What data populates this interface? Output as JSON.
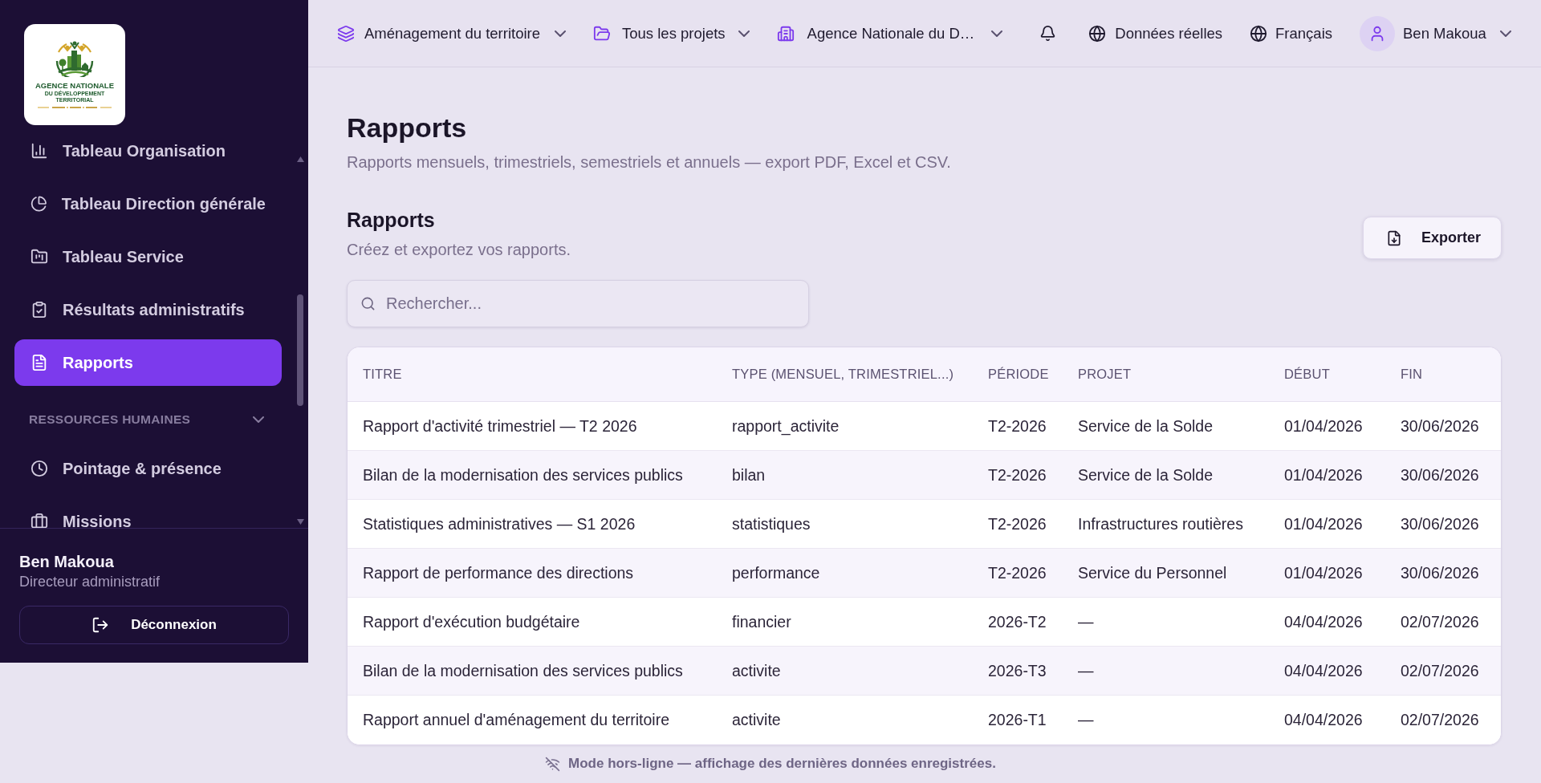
{
  "sidebar": {
    "logo": {
      "title": "AGENCE NATIONALE",
      "subtitle": "DU DÉVELOPPEMENT TERRITORIAL"
    },
    "nav": [
      {
        "kind": "item",
        "label": "Tableau Organisation",
        "selected": false
      },
      {
        "kind": "item",
        "label": "Tableau Direction générale",
        "selected": false
      },
      {
        "kind": "item",
        "label": "Tableau Service",
        "selected": false
      },
      {
        "kind": "item",
        "label": "Résultats administratifs",
        "selected": false
      },
      {
        "kind": "item",
        "label": "Rapports",
        "selected": true
      },
      {
        "kind": "section",
        "label": "RESSOURCES HUMAINES",
        "expanded": true
      },
      {
        "kind": "item",
        "label": "Pointage & présence",
        "selected": false
      },
      {
        "kind": "item",
        "label": "Missions",
        "selected": false
      }
    ],
    "user": {
      "name": "Ben Makoua",
      "role": "Directeur administratif"
    },
    "logout_button": "Déconnexion"
  },
  "topbar": {
    "selectors": [
      {
        "label": "Aménagement du territoire"
      },
      {
        "label": "Tous les projets"
      },
      {
        "label": "Agence Nationale du D…"
      }
    ],
    "data_source": "Données réelles",
    "language": "Français",
    "user_name": "Ben Makoua"
  },
  "page": {
    "title": "Rapports",
    "subtitle": "Rapports mensuels, trimestriels, semestriels et annuels — export PDF, Excel et CSV."
  },
  "section": {
    "title": "Rapports",
    "subtitle": "Créez et exportez vos rapports.",
    "export_button": "Exporter"
  },
  "search": {
    "placeholder": "Rechercher..."
  },
  "table": {
    "columns": [
      "TITRE",
      "TYPE (MENSUEL, TRIMESTRIEL...)",
      "PÉRIODE",
      "PROJET",
      "DÉBUT",
      "FIN"
    ],
    "rows": [
      [
        "Rapport d'activité trimestriel — T2 2026",
        "rapport_activite",
        "T2-2026",
        "Service de la Solde",
        "01/04/2026",
        "30/06/2026"
      ],
      [
        "Bilan de la modernisation des services publics",
        "bilan",
        "T2-2026",
        "Service de la Solde",
        "01/04/2026",
        "30/06/2026"
      ],
      [
        "Statistiques administratives — S1 2026",
        "statistiques",
        "T2-2026",
        "Infrastructures routières",
        "01/04/2026",
        "30/06/2026"
      ],
      [
        "Rapport de performance des directions",
        "performance",
        "T2-2026",
        "Service du Personnel",
        "01/04/2026",
        "30/06/2026"
      ],
      [
        "Rapport d'exécution budgétaire",
        "financier",
        "2026-T2",
        "—",
        "04/04/2026",
        "02/07/2026"
      ],
      [
        "Bilan de la modernisation des services publics",
        "activite",
        "2026-T3",
        "—",
        "04/04/2026",
        "02/07/2026"
      ],
      [
        "Rapport annuel d'aménagement du territoire",
        "activite",
        "2026-T1",
        "—",
        "04/04/2026",
        "02/07/2026"
      ]
    ]
  },
  "status_bar": {
    "text": "Mode hors-ligne — affichage des dernières données enregistrées."
  }
}
